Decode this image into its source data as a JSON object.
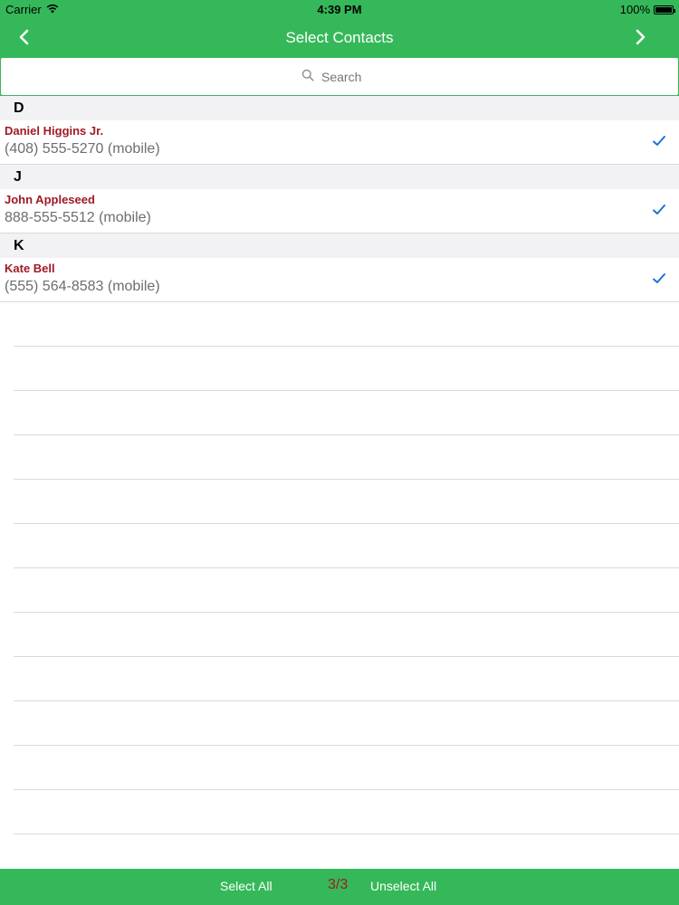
{
  "status_bar": {
    "carrier": "Carrier",
    "time": "4:39 PM",
    "battery": "100%"
  },
  "nav": {
    "title": "Select Contacts",
    "back_icon": "chevron-left-icon",
    "forward_icon": "chevron-right-icon"
  },
  "search": {
    "placeholder": "Search",
    "value": ""
  },
  "sections": [
    {
      "letter": "D",
      "contacts": [
        {
          "name": "Daniel Higgins Jr.",
          "phone": "(408) 555-5270 (mobile)",
          "selected": true
        }
      ]
    },
    {
      "letter": "J",
      "contacts": [
        {
          "name": "John Appleseed",
          "phone": "888-555-5512 (mobile)",
          "selected": true
        }
      ]
    },
    {
      "letter": "K",
      "contacts": [
        {
          "name": "Kate Bell",
          "phone": "(555) 564-8583 (mobile)",
          "selected": true
        }
      ]
    }
  ],
  "bottom_bar": {
    "select_all": "Select All",
    "count": "3/3",
    "unselect_all": "Unselect All"
  },
  "colors": {
    "accent": "#35b859",
    "contact_name": "#a01a24",
    "checkmark": "#1a73d9"
  }
}
